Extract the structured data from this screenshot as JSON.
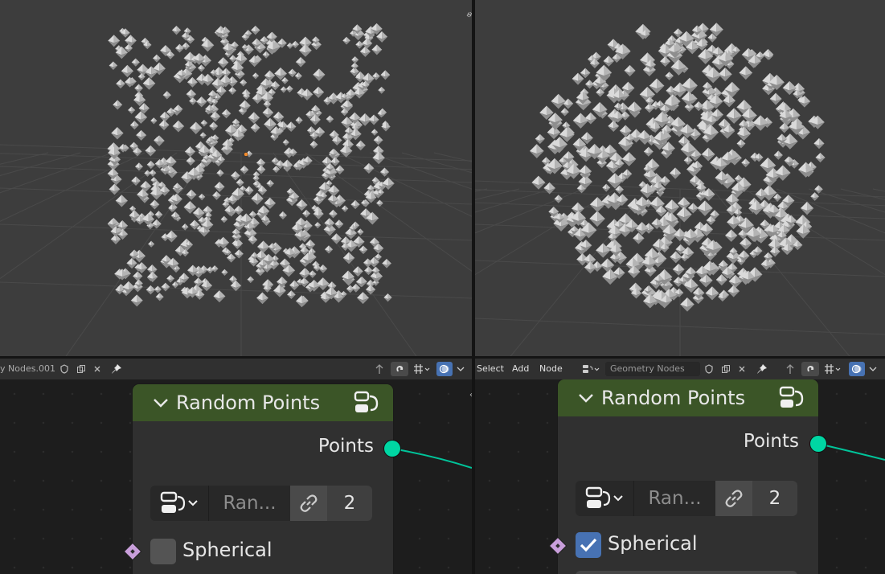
{
  "left_header": {
    "tree_name": "y Nodes.001",
    "icons": [
      "shield-icon",
      "duplicate-icon",
      "close-icon",
      "pin-icon",
      "parent-icon",
      "snap-icon",
      "grid-icon",
      "overlay-icon"
    ]
  },
  "right_header": {
    "menu": [
      "Select",
      "Add",
      "Node"
    ],
    "tree_name": "Geometry Nodes",
    "icons": [
      "node-tree-icon",
      "shield-icon",
      "duplicate-icon",
      "close-icon",
      "pin-icon",
      "parent-icon",
      "snap-icon",
      "grid-icon",
      "overlay-icon"
    ]
  },
  "left_node": {
    "title": "Random Points",
    "output_label": "Points",
    "field_name": "Ran...",
    "field_value": "2",
    "checkbox_label": "Spherical",
    "checkbox_checked": false
  },
  "right_node": {
    "title": "Random Points",
    "output_label": "Points",
    "field_name": "Ran...",
    "field_value": "2",
    "checkbox_label": "Spherical",
    "checkbox_checked": true
  },
  "colors": {
    "viewport_bg": "#3d3d3d",
    "node_header": "#3b5527",
    "node_body": "#303030",
    "geometry_socket": "#00d6a3",
    "bool_socket": "#c99fdb",
    "checkbox_checked": "#4772b3",
    "origin_dot": "#f28a2b"
  },
  "viewport_left": {
    "cloud_shape": "cube",
    "origin_marker": true
  },
  "viewport_right": {
    "cloud_shape": "sphere",
    "origin_marker": false
  }
}
